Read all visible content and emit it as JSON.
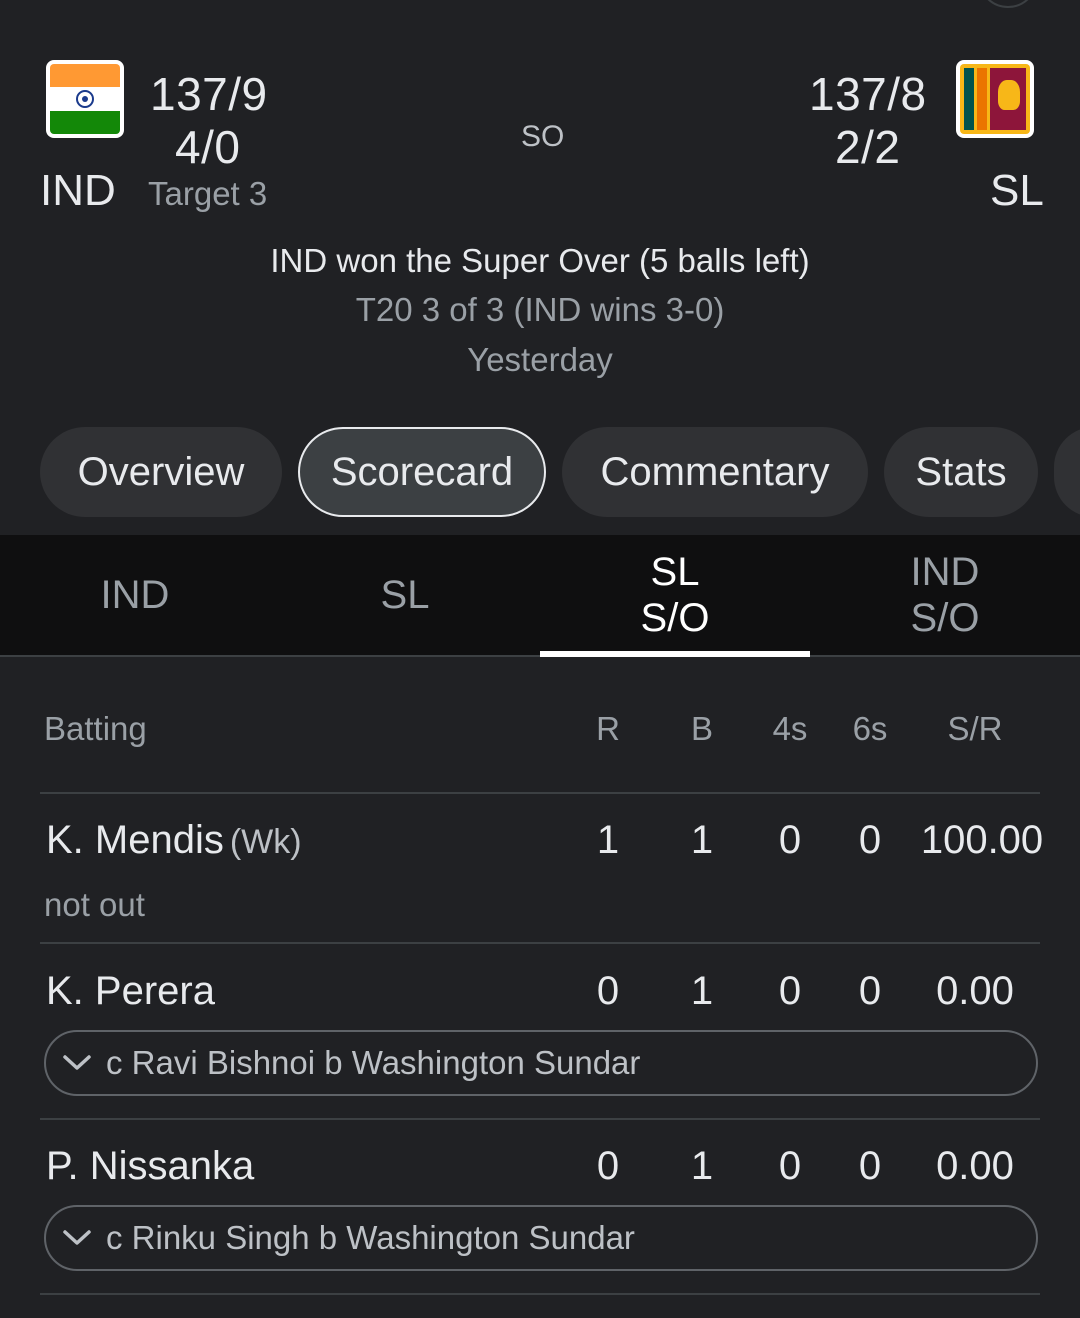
{
  "match": {
    "team1": {
      "abbr": "IND",
      "score": "137/9",
      "super_over": "4/0",
      "target": "Target 3"
    },
    "team2": {
      "abbr": "SL",
      "score": "137/8",
      "super_over": "2/2"
    },
    "status_short": "SO",
    "result": "IND won the Super Over (5 balls left)",
    "series": "T20 3 of 3 (IND wins 3-0)",
    "date": "Yesterday"
  },
  "nav_tabs": [
    "Overview",
    "Scorecard",
    "Commentary",
    "Stats"
  ],
  "active_nav_tab": "Scorecard",
  "innings_tabs": [
    {
      "line1": "IND",
      "line2": ""
    },
    {
      "line1": "SL",
      "line2": ""
    },
    {
      "line1": "SL",
      "line2": "S/O"
    },
    {
      "line1": "IND",
      "line2": "S/O"
    }
  ],
  "active_innings_tab": "SL S/O",
  "batting": {
    "headers": {
      "label": "Batting",
      "r": "R",
      "b": "B",
      "fours": "4s",
      "sixes": "6s",
      "sr": "S/R"
    },
    "rows": [
      {
        "name": "K. Mendis",
        "role": "(Wk)",
        "r": "1",
        "b": "1",
        "fours": "0",
        "sixes": "0",
        "sr": "100.00",
        "dismissal": "not out"
      },
      {
        "name": "K. Perera",
        "role": "",
        "r": "0",
        "b": "1",
        "fours": "0",
        "sixes": "0",
        "sr": "0.00",
        "dismissal": "c Ravi Bishnoi b Washington Sundar"
      },
      {
        "name": "P. Nissanka",
        "role": "",
        "r": "0",
        "b": "1",
        "fours": "0",
        "sixes": "0",
        "sr": "0.00",
        "dismissal": "c Rinku Singh b Washington Sundar"
      }
    ]
  },
  "icons": {
    "flag_ind": "india-flag-icon",
    "flag_sl": "sri-lanka-flag-icon",
    "expand": "chevron-down-icon"
  },
  "colors": {
    "background": "#202124",
    "chip": "#303134",
    "innings_bar": "#0f0f10",
    "text_primary": "#e8eaed",
    "text_secondary": "#9aa0a6"
  }
}
